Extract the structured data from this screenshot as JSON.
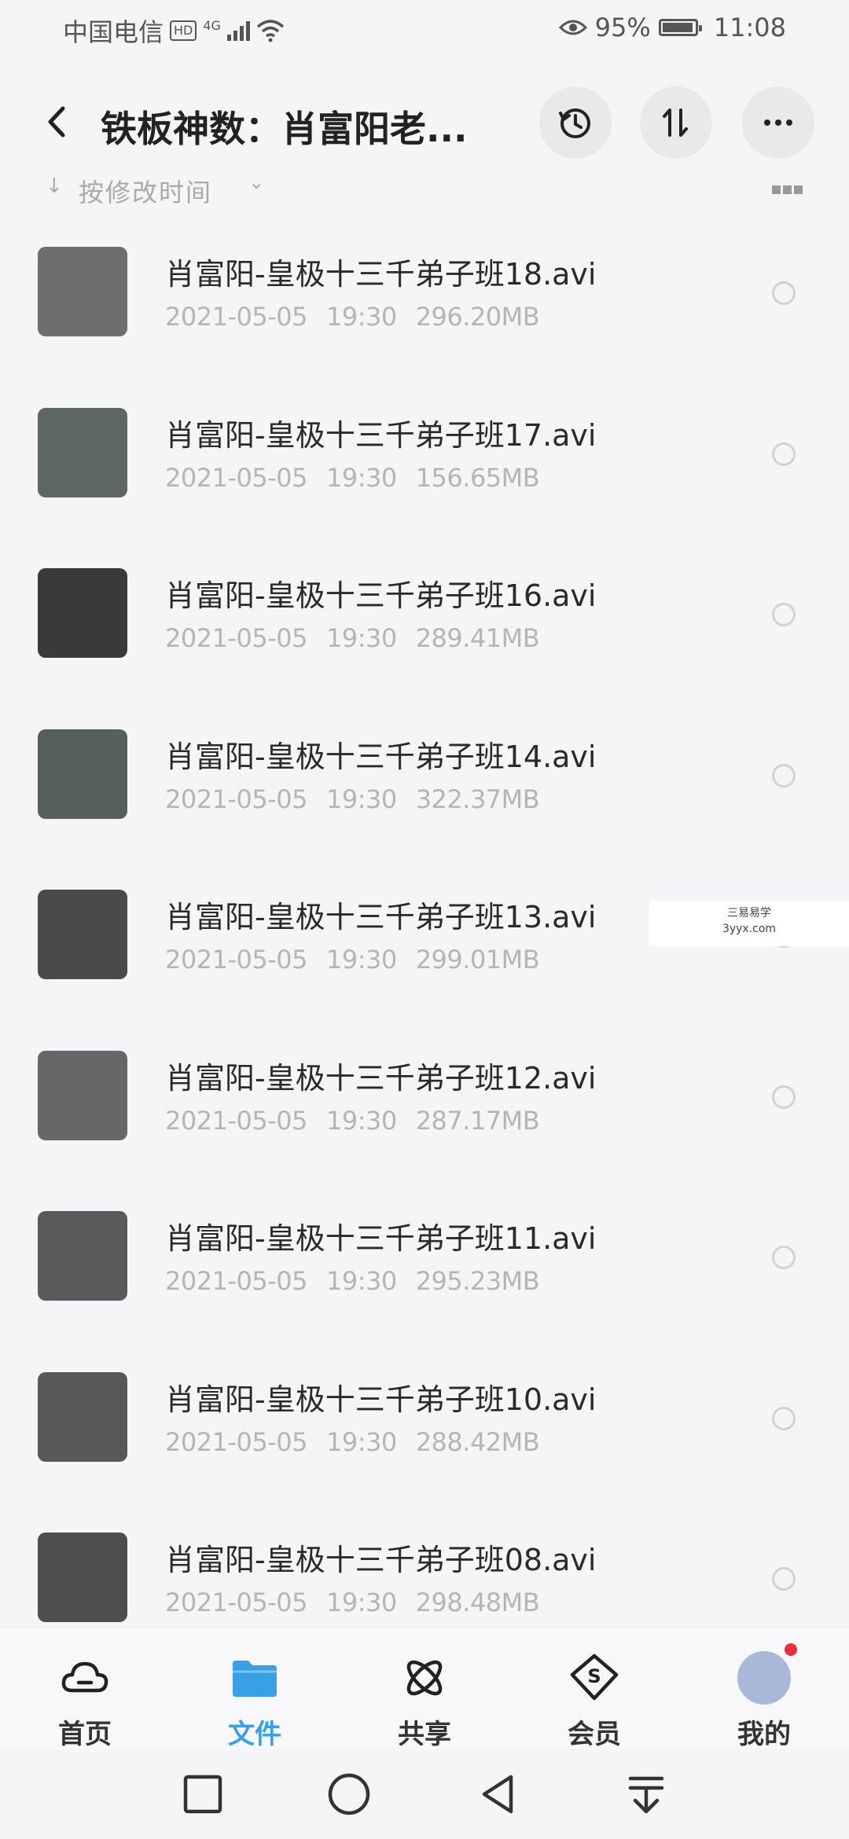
{
  "status_bar": {
    "carrier": "中国电信",
    "hd_badge": "HD",
    "network": "4G",
    "battery": "95%",
    "time": "11:08"
  },
  "header": {
    "title": "铁板神数：肖富阳老...",
    "icons": [
      "back-icon",
      "history-icon",
      "sort-icon",
      "more-icon"
    ]
  },
  "sort_row": {
    "label": "按修改时间",
    "arrow": "↓",
    "chevron": "⌄"
  },
  "files": [
    {
      "name": "肖富阳-皇极十三千弟子班18.avi",
      "date": "2021-05-05",
      "time": "19:30",
      "size": "296.20MB"
    },
    {
      "name": "肖富阳-皇极十三千弟子班17.avi",
      "date": "2021-05-05",
      "time": "19:30",
      "size": "156.65MB"
    },
    {
      "name": "肖富阳-皇极十三千弟子班16.avi",
      "date": "2021-05-05",
      "time": "19:30",
      "size": "289.41MB"
    },
    {
      "name": "肖富阳-皇极十三千弟子班14.avi",
      "date": "2021-05-05",
      "time": "19:30",
      "size": "322.37MB"
    },
    {
      "name": "肖富阳-皇极十三千弟子班13.avi",
      "date": "2021-05-05",
      "time": "19:30",
      "size": "299.01MB"
    },
    {
      "name": "肖富阳-皇极十三千弟子班12.avi",
      "date": "2021-05-05",
      "time": "19:30",
      "size": "287.17MB"
    },
    {
      "name": "肖富阳-皇极十三千弟子班11.avi",
      "date": "2021-05-05",
      "time": "19:30",
      "size": "295.23MB"
    },
    {
      "name": "肖富阳-皇极十三千弟子班10.avi",
      "date": "2021-05-05",
      "time": "19:30",
      "size": "288.42MB"
    },
    {
      "name": "肖富阳-皇极十三千弟子班08.avi",
      "date": "2021-05-05",
      "time": "19:30",
      "size": "298.48MB"
    }
  ],
  "watermark": {
    "line1": "三易易学",
    "line2": "3yyx.com"
  },
  "tabs": [
    {
      "label": "首页",
      "icon": "cloud-icon",
      "active": false
    },
    {
      "label": "文件",
      "icon": "folder-icon",
      "active": true
    },
    {
      "label": "共享",
      "icon": "share-icon",
      "active": false
    },
    {
      "label": "会员",
      "icon": "vip-icon",
      "active": false
    },
    {
      "label": "我的",
      "icon": "avatar-icon",
      "active": false
    }
  ],
  "colors": {
    "accent": "#3aa0e6",
    "background": "#f5f5f7",
    "meta_text": "#b5b5b5",
    "badge": "#e6303e"
  }
}
